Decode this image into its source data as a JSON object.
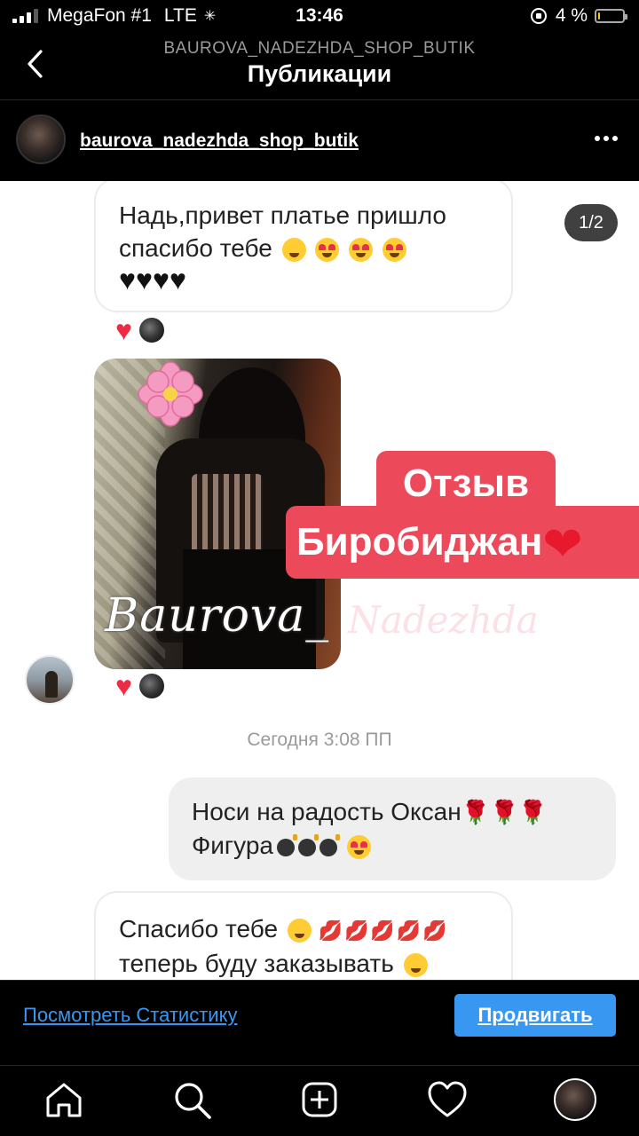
{
  "status_bar": {
    "carrier": "MegaFon #1",
    "network": "LTE",
    "time": "13:46",
    "battery": "4 %",
    "battery_level": 0.04
  },
  "header": {
    "subtitle": "BAUROVA_NADEZHDA_SHOP_BUTIK",
    "title": "Публикации"
  },
  "post": {
    "username": "baurova_nadezhda_shop_butik",
    "counter": "1/2",
    "messages": {
      "m1_line1": "Надь,привет платье пришло",
      "m1_line2": "спасибо тебе",
      "m2_line1": "Носи на радость Оксан",
      "m2_line2": "Фигура",
      "m3_line1": "Спасибо тебе",
      "m3_line2": "теперь буду заказывать"
    },
    "overlay_line1": "Отзыв",
    "overlay_line2": "Биробиджан",
    "watermark_1": "Baurova_",
    "watermark_2": "Nadezhda",
    "timestamp": "Сегодня 3:08 ПП"
  },
  "promo": {
    "stats_link": "Посмотреть Статистику",
    "promote_button": "Продвигать"
  },
  "tabbar": {
    "items": [
      "home-icon",
      "search-icon",
      "new-post-icon",
      "activity-heart-icon",
      "profile-avatar"
    ]
  },
  "colors": {
    "accent_blue": "#3897f0",
    "review_tag": "#ec4a5a",
    "heart_red": "#ed2b44"
  }
}
